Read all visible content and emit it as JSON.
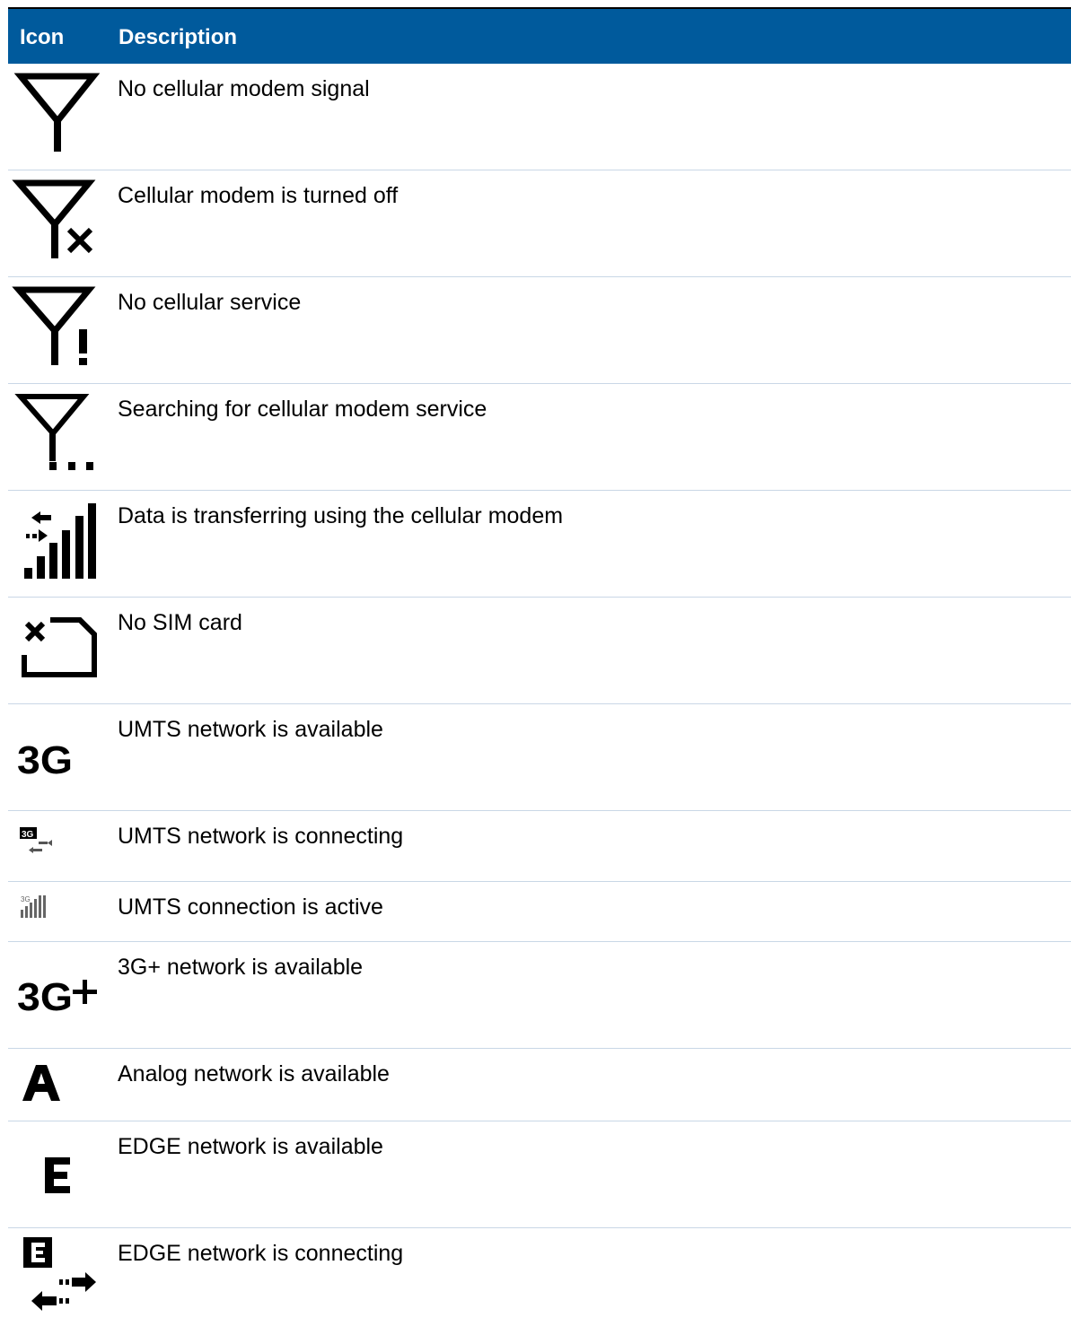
{
  "header": {
    "icon_label": "Icon",
    "description_label": "Description"
  },
  "rows": [
    {
      "icon": "antenna-no-signal-icon",
      "description": "No cellular modem signal"
    },
    {
      "icon": "antenna-off-icon",
      "description": "Cellular modem is turned off"
    },
    {
      "icon": "antenna-no-service-icon",
      "description": "No cellular service"
    },
    {
      "icon": "antenna-searching-icon",
      "description": "Searching for cellular modem service"
    },
    {
      "icon": "data-transfer-signal-icon",
      "description": "Data is transferring using the cellular modem"
    },
    {
      "icon": "no-sim-card-icon",
      "description": "No SIM card"
    },
    {
      "icon": "3g-icon",
      "description": "UMTS network is available"
    },
    {
      "icon": "3g-connecting-icon",
      "description": "UMTS network is connecting"
    },
    {
      "icon": "3g-active-icon",
      "description": "UMTS connection is active"
    },
    {
      "icon": "3g-plus-icon",
      "description": "3G+ network is available"
    },
    {
      "icon": "analog-network-icon",
      "description": "Analog network is available"
    },
    {
      "icon": "edge-network-icon",
      "description": "EDGE network is available"
    },
    {
      "icon": "edge-connecting-icon",
      "description": "EDGE network is connecting"
    }
  ],
  "colors": {
    "header_bg": "#005a9c",
    "header_text": "#ffffff",
    "row_divider": "#c9d7e6"
  }
}
